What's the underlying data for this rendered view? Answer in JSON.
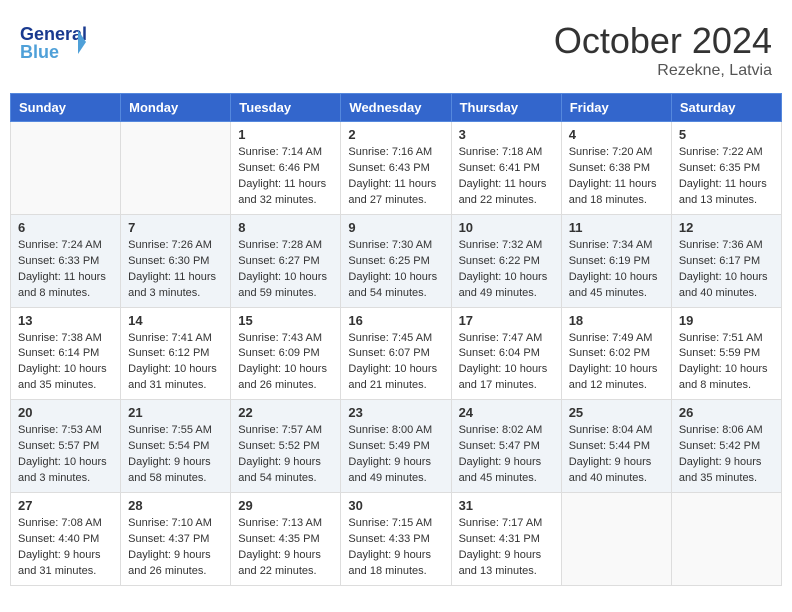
{
  "header": {
    "logo_line1": "General",
    "logo_line2": "Blue",
    "month": "October 2024",
    "location": "Rezekne, Latvia"
  },
  "days_of_week": [
    "Sunday",
    "Monday",
    "Tuesday",
    "Wednesday",
    "Thursday",
    "Friday",
    "Saturday"
  ],
  "weeks": [
    [
      {
        "day": "",
        "sunrise": "",
        "sunset": "",
        "daylight": ""
      },
      {
        "day": "",
        "sunrise": "",
        "sunset": "",
        "daylight": ""
      },
      {
        "day": "1",
        "sunrise": "Sunrise: 7:14 AM",
        "sunset": "Sunset: 6:46 PM",
        "daylight": "Daylight: 11 hours and 32 minutes."
      },
      {
        "day": "2",
        "sunrise": "Sunrise: 7:16 AM",
        "sunset": "Sunset: 6:43 PM",
        "daylight": "Daylight: 11 hours and 27 minutes."
      },
      {
        "day": "3",
        "sunrise": "Sunrise: 7:18 AM",
        "sunset": "Sunset: 6:41 PM",
        "daylight": "Daylight: 11 hours and 22 minutes."
      },
      {
        "day": "4",
        "sunrise": "Sunrise: 7:20 AM",
        "sunset": "Sunset: 6:38 PM",
        "daylight": "Daylight: 11 hours and 18 minutes."
      },
      {
        "day": "5",
        "sunrise": "Sunrise: 7:22 AM",
        "sunset": "Sunset: 6:35 PM",
        "daylight": "Daylight: 11 hours and 13 minutes."
      }
    ],
    [
      {
        "day": "6",
        "sunrise": "Sunrise: 7:24 AM",
        "sunset": "Sunset: 6:33 PM",
        "daylight": "Daylight: 11 hours and 8 minutes."
      },
      {
        "day": "7",
        "sunrise": "Sunrise: 7:26 AM",
        "sunset": "Sunset: 6:30 PM",
        "daylight": "Daylight: 11 hours and 3 minutes."
      },
      {
        "day": "8",
        "sunrise": "Sunrise: 7:28 AM",
        "sunset": "Sunset: 6:27 PM",
        "daylight": "Daylight: 10 hours and 59 minutes."
      },
      {
        "day": "9",
        "sunrise": "Sunrise: 7:30 AM",
        "sunset": "Sunset: 6:25 PM",
        "daylight": "Daylight: 10 hours and 54 minutes."
      },
      {
        "day": "10",
        "sunrise": "Sunrise: 7:32 AM",
        "sunset": "Sunset: 6:22 PM",
        "daylight": "Daylight: 10 hours and 49 minutes."
      },
      {
        "day": "11",
        "sunrise": "Sunrise: 7:34 AM",
        "sunset": "Sunset: 6:19 PM",
        "daylight": "Daylight: 10 hours and 45 minutes."
      },
      {
        "day": "12",
        "sunrise": "Sunrise: 7:36 AM",
        "sunset": "Sunset: 6:17 PM",
        "daylight": "Daylight: 10 hours and 40 minutes."
      }
    ],
    [
      {
        "day": "13",
        "sunrise": "Sunrise: 7:38 AM",
        "sunset": "Sunset: 6:14 PM",
        "daylight": "Daylight: 10 hours and 35 minutes."
      },
      {
        "day": "14",
        "sunrise": "Sunrise: 7:41 AM",
        "sunset": "Sunset: 6:12 PM",
        "daylight": "Daylight: 10 hours and 31 minutes."
      },
      {
        "day": "15",
        "sunrise": "Sunrise: 7:43 AM",
        "sunset": "Sunset: 6:09 PM",
        "daylight": "Daylight: 10 hours and 26 minutes."
      },
      {
        "day": "16",
        "sunrise": "Sunrise: 7:45 AM",
        "sunset": "Sunset: 6:07 PM",
        "daylight": "Daylight: 10 hours and 21 minutes."
      },
      {
        "day": "17",
        "sunrise": "Sunrise: 7:47 AM",
        "sunset": "Sunset: 6:04 PM",
        "daylight": "Daylight: 10 hours and 17 minutes."
      },
      {
        "day": "18",
        "sunrise": "Sunrise: 7:49 AM",
        "sunset": "Sunset: 6:02 PM",
        "daylight": "Daylight: 10 hours and 12 minutes."
      },
      {
        "day": "19",
        "sunrise": "Sunrise: 7:51 AM",
        "sunset": "Sunset: 5:59 PM",
        "daylight": "Daylight: 10 hours and 8 minutes."
      }
    ],
    [
      {
        "day": "20",
        "sunrise": "Sunrise: 7:53 AM",
        "sunset": "Sunset: 5:57 PM",
        "daylight": "Daylight: 10 hours and 3 minutes."
      },
      {
        "day": "21",
        "sunrise": "Sunrise: 7:55 AM",
        "sunset": "Sunset: 5:54 PM",
        "daylight": "Daylight: 9 hours and 58 minutes."
      },
      {
        "day": "22",
        "sunrise": "Sunrise: 7:57 AM",
        "sunset": "Sunset: 5:52 PM",
        "daylight": "Daylight: 9 hours and 54 minutes."
      },
      {
        "day": "23",
        "sunrise": "Sunrise: 8:00 AM",
        "sunset": "Sunset: 5:49 PM",
        "daylight": "Daylight: 9 hours and 49 minutes."
      },
      {
        "day": "24",
        "sunrise": "Sunrise: 8:02 AM",
        "sunset": "Sunset: 5:47 PM",
        "daylight": "Daylight: 9 hours and 45 minutes."
      },
      {
        "day": "25",
        "sunrise": "Sunrise: 8:04 AM",
        "sunset": "Sunset: 5:44 PM",
        "daylight": "Daylight: 9 hours and 40 minutes."
      },
      {
        "day": "26",
        "sunrise": "Sunrise: 8:06 AM",
        "sunset": "Sunset: 5:42 PM",
        "daylight": "Daylight: 9 hours and 35 minutes."
      }
    ],
    [
      {
        "day": "27",
        "sunrise": "Sunrise: 7:08 AM",
        "sunset": "Sunset: 4:40 PM",
        "daylight": "Daylight: 9 hours and 31 minutes."
      },
      {
        "day": "28",
        "sunrise": "Sunrise: 7:10 AM",
        "sunset": "Sunset: 4:37 PM",
        "daylight": "Daylight: 9 hours and 26 minutes."
      },
      {
        "day": "29",
        "sunrise": "Sunrise: 7:13 AM",
        "sunset": "Sunset: 4:35 PM",
        "daylight": "Daylight: 9 hours and 22 minutes."
      },
      {
        "day": "30",
        "sunrise": "Sunrise: 7:15 AM",
        "sunset": "Sunset: 4:33 PM",
        "daylight": "Daylight: 9 hours and 18 minutes."
      },
      {
        "day": "31",
        "sunrise": "Sunrise: 7:17 AM",
        "sunset": "Sunset: 4:31 PM",
        "daylight": "Daylight: 9 hours and 13 minutes."
      },
      {
        "day": "",
        "sunrise": "",
        "sunset": "",
        "daylight": ""
      },
      {
        "day": "",
        "sunrise": "",
        "sunset": "",
        "daylight": ""
      }
    ]
  ]
}
